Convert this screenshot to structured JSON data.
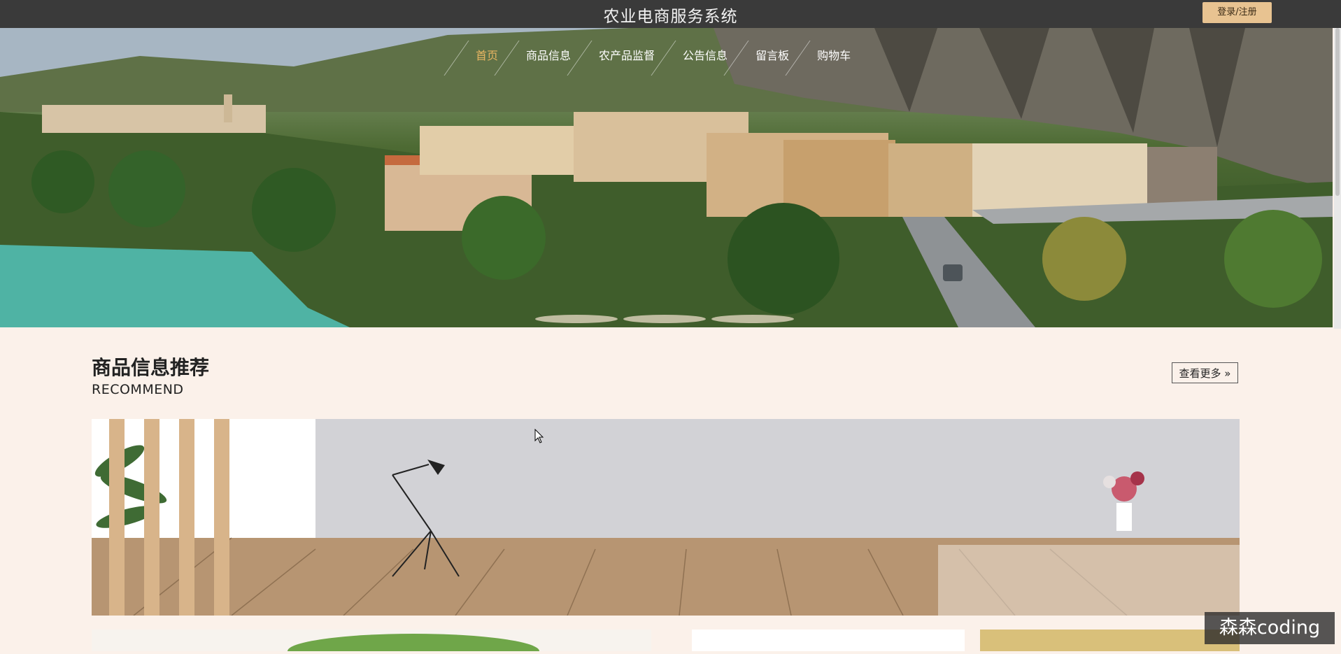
{
  "header": {
    "site_title": "农业电商服务系统",
    "login_label": "登录/注册"
  },
  "nav": {
    "items": [
      {
        "label": "首页",
        "active": true
      },
      {
        "label": "商品信息"
      },
      {
        "label": "农产品监督"
      },
      {
        "label": "公告信息"
      },
      {
        "label": "留言板"
      },
      {
        "label": "购物车"
      }
    ]
  },
  "carousel": {
    "slide_count": 3,
    "active_slide": 1
  },
  "recommend": {
    "title": "商品信息推荐",
    "subtitle": "RECOMMEND",
    "more_label": "查看更多 »"
  },
  "watermark": "森森coding",
  "colors": {
    "topbar": "#3a3a3a",
    "accent": "#e8c391",
    "nav_active": "#e8b562",
    "page_bg": "#fbf1ea"
  }
}
